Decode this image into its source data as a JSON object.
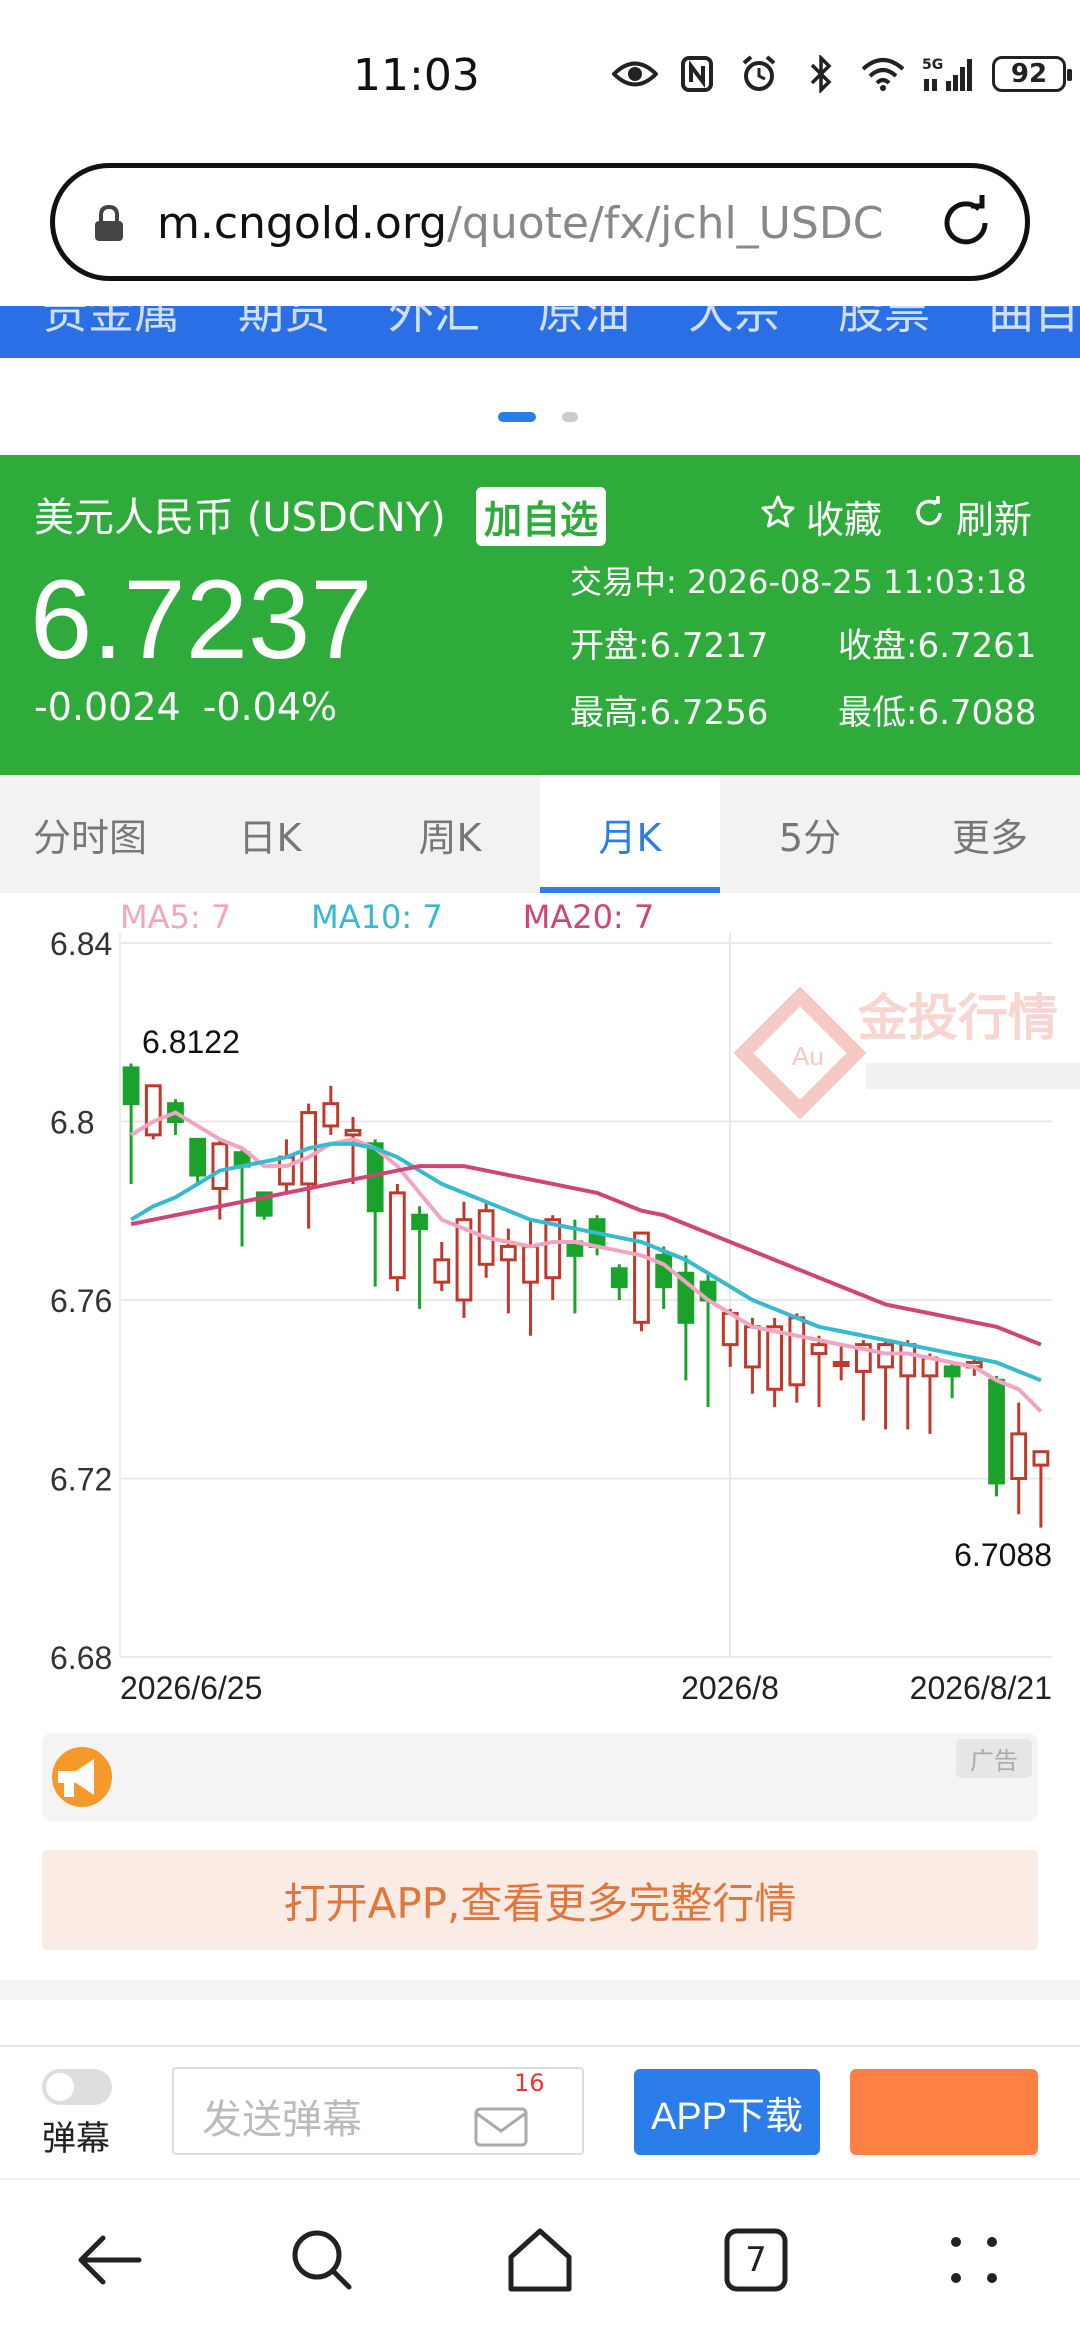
{
  "status_bar": {
    "time": "11:03",
    "battery": "92",
    "network": "5G"
  },
  "browser": {
    "url_domain": "m.cngold.org",
    "url_path": "/quote/fx/jchl_USDC"
  },
  "nav_strip": {
    "items": [
      "贵金属",
      "期货",
      "外汇",
      "原油",
      "大宗",
      "股票",
      "曲目"
    ]
  },
  "quote": {
    "name": "美元人民币 (USDCNY)",
    "add_watch": "加自选",
    "favorite": "收藏",
    "refresh": "刷新",
    "price": "6.7237",
    "change": "-0.0024",
    "change_pct": "-0.04%",
    "status": "交易中:  2026-08-25 11:03:18",
    "open": "开盘:6.7217",
    "close": "收盘:6.7261",
    "high": "最高:6.7256",
    "low": "最低:6.7088"
  },
  "tabs": [
    {
      "label": "分时图",
      "active": false
    },
    {
      "label": "日K",
      "active": false
    },
    {
      "label": "周K",
      "active": false
    },
    {
      "label": "月K",
      "active": true
    },
    {
      "label": "5分",
      "active": false
    },
    {
      "label": "更多",
      "active": false
    }
  ],
  "ma_legend": {
    "ma5": "MA5: 7",
    "ma10": "MA10: 7",
    "ma20": "MA20: 7"
  },
  "chart_data": {
    "type": "candlestick",
    "y_ticks": [
      "6.84",
      "6.8",
      "6.76",
      "6.72",
      "6.68"
    ],
    "ylim": [
      6.68,
      6.84
    ],
    "x_labels": [
      "2026/6/25",
      "2026/8",
      "2026/8/21"
    ],
    "max_label": "6.8122",
    "min_label": "6.7088",
    "watermark": "金投行情",
    "colors": {
      "up": "#c0392b",
      "down": "#1aa32a",
      "ma5": "#f2a5c0",
      "ma10": "#37b9cf",
      "ma20": "#d04478"
    },
    "candles": [
      {
        "o": 6.804,
        "c": 6.812,
        "h": 6.813,
        "l": 6.786,
        "dir": "down"
      },
      {
        "o": 6.808,
        "c": 6.797,
        "h": 6.808,
        "l": 6.796,
        "dir": "up"
      },
      {
        "o": 6.804,
        "c": 6.8,
        "h": 6.805,
        "l": 6.797,
        "dir": "down"
      },
      {
        "o": 6.796,
        "c": 6.788,
        "h": 6.796,
        "l": 6.786,
        "dir": "down"
      },
      {
        "o": 6.785,
        "c": 6.795,
        "h": 6.796,
        "l": 6.778,
        "dir": "up"
      },
      {
        "o": 6.79,
        "c": 6.793,
        "h": 6.794,
        "l": 6.772,
        "dir": "down"
      },
      {
        "o": 6.784,
        "c": 6.779,
        "h": 6.784,
        "l": 6.778,
        "dir": "down"
      },
      {
        "o": 6.786,
        "c": 6.792,
        "h": 6.796,
        "l": 6.784,
        "dir": "up"
      },
      {
        "o": 6.786,
        "c": 6.802,
        "h": 6.804,
        "l": 6.776,
        "dir": "up"
      },
      {
        "o": 6.799,
        "c": 6.804,
        "h": 6.808,
        "l": 6.797,
        "dir": "up"
      },
      {
        "o": 6.798,
        "c": 6.797,
        "h": 6.801,
        "l": 6.786,
        "dir": "up"
      },
      {
        "o": 6.795,
        "c": 6.78,
        "h": 6.796,
        "l": 6.763,
        "dir": "down"
      },
      {
        "o": 6.765,
        "c": 6.784,
        "h": 6.786,
        "l": 6.762,
        "dir": "up"
      },
      {
        "o": 6.779,
        "c": 6.776,
        "h": 6.781,
        "l": 6.758,
        "dir": "down"
      },
      {
        "o": 6.764,
        "c": 6.769,
        "h": 6.773,
        "l": 6.762,
        "dir": "up"
      },
      {
        "o": 6.76,
        "c": 6.778,
        "h": 6.782,
        "l": 6.756,
        "dir": "up"
      },
      {
        "o": 6.768,
        "c": 6.78,
        "h": 6.782,
        "l": 6.765,
        "dir": "up"
      },
      {
        "o": 6.769,
        "c": 6.772,
        "h": 6.776,
        "l": 6.757,
        "dir": "up"
      },
      {
        "o": 6.764,
        "c": 6.772,
        "h": 6.778,
        "l": 6.752,
        "dir": "up"
      },
      {
        "o": 6.765,
        "c": 6.778,
        "h": 6.779,
        "l": 6.76,
        "dir": "up"
      },
      {
        "o": 6.77,
        "c": 6.773,
        "h": 6.778,
        "l": 6.757,
        "dir": "down"
      },
      {
        "o": 6.778,
        "c": 6.772,
        "h": 6.779,
        "l": 6.77,
        "dir": "down"
      },
      {
        "o": 6.767,
        "c": 6.763,
        "h": 6.768,
        "l": 6.76,
        "dir": "down"
      },
      {
        "o": 6.755,
        "c": 6.775,
        "h": 6.775,
        "l": 6.753,
        "dir": "up"
      },
      {
        "o": 6.77,
        "c": 6.763,
        "h": 6.772,
        "l": 6.758,
        "dir": "down"
      },
      {
        "o": 6.766,
        "c": 6.755,
        "h": 6.77,
        "l": 6.742,
        "dir": "down"
      },
      {
        "o": 6.764,
        "c": 6.76,
        "h": 6.766,
        "l": 6.736,
        "dir": "down"
      },
      {
        "o": 6.757,
        "c": 6.75,
        "h": 6.758,
        "l": 6.745,
        "dir": "up"
      },
      {
        "o": 6.745,
        "c": 6.754,
        "h": 6.756,
        "l": 6.739,
        "dir": "up"
      },
      {
        "o": 6.74,
        "c": 6.754,
        "h": 6.756,
        "l": 6.736,
        "dir": "up"
      },
      {
        "o": 6.741,
        "c": 6.756,
        "h": 6.757,
        "l": 6.737,
        "dir": "up"
      },
      {
        "o": 6.748,
        "c": 6.75,
        "h": 6.752,
        "l": 6.736,
        "dir": "up"
      },
      {
        "o": 6.746,
        "c": 6.746,
        "h": 6.75,
        "l": 6.742,
        "dir": "up"
      },
      {
        "o": 6.744,
        "c": 6.75,
        "h": 6.751,
        "l": 6.733,
        "dir": "up"
      },
      {
        "o": 6.745,
        "c": 6.75,
        "h": 6.751,
        "l": 6.731,
        "dir": "up"
      },
      {
        "o": 6.743,
        "c": 6.75,
        "h": 6.751,
        "l": 6.731,
        "dir": "up"
      },
      {
        "o": 6.743,
        "c": 6.747,
        "h": 6.748,
        "l": 6.73,
        "dir": "up"
      },
      {
        "o": 6.745,
        "c": 6.743,
        "h": 6.746,
        "l": 6.738,
        "dir": "down"
      },
      {
        "o": 6.746,
        "c": 6.745,
        "h": 6.747,
        "l": 6.743,
        "dir": "up"
      },
      {
        "o": 6.742,
        "c": 6.719,
        "h": 6.743,
        "l": 6.716,
        "dir": "down"
      },
      {
        "o": 6.72,
        "c": 6.73,
        "h": 6.737,
        "l": 6.712,
        "dir": "up"
      },
      {
        "o": 6.723,
        "c": 6.726,
        "h": 6.726,
        "l": 6.709,
        "dir": "up"
      }
    ],
    "ma5": [
      6.797,
      6.8,
      6.802,
      6.799,
      6.796,
      6.794,
      6.79,
      6.79,
      6.792,
      6.795,
      6.796,
      6.794,
      6.79,
      6.784,
      6.778,
      6.776,
      6.774,
      6.773,
      6.772,
      6.773,
      6.773,
      6.772,
      6.771,
      6.77,
      6.768,
      6.764,
      6.76,
      6.757,
      6.754,
      6.753,
      6.752,
      6.751,
      6.75,
      6.749,
      6.748,
      6.748,
      6.747,
      6.746,
      6.745,
      6.742,
      6.74,
      6.735
    ],
    "ma10": [
      6.778,
      6.781,
      6.783,
      6.786,
      6.789,
      6.79,
      6.791,
      6.792,
      6.794,
      6.795,
      6.795,
      6.794,
      6.792,
      6.789,
      6.786,
      6.784,
      6.782,
      6.78,
      6.778,
      6.777,
      6.776,
      6.775,
      6.774,
      6.773,
      6.771,
      6.769,
      6.766,
      6.763,
      6.76,
      6.758,
      6.756,
      6.754,
      6.753,
      6.752,
      6.751,
      6.75,
      6.749,
      6.748,
      6.747,
      6.746,
      6.744,
      6.742
    ],
    "ma20": [
      6.777,
      6.778,
      6.779,
      6.78,
      6.781,
      6.782,
      6.783,
      6.784,
      6.785,
      6.786,
      6.787,
      6.788,
      6.789,
      6.79,
      6.79,
      6.79,
      6.789,
      6.788,
      6.787,
      6.786,
      6.785,
      6.784,
      6.782,
      6.78,
      6.779,
      6.777,
      6.775,
      6.773,
      6.771,
      6.769,
      6.767,
      6.765,
      6.763,
      6.761,
      6.759,
      6.758,
      6.757,
      6.756,
      6.755,
      6.754,
      6.752,
      6.75
    ]
  },
  "ad": {
    "tag": "广告",
    "open_app": "打开APP,查看更多完整行情"
  },
  "action_bar": {
    "danmu_label": "弹幕",
    "danmu_placeholder": "发送弹幕",
    "mail_count": "16",
    "app_download": "APP下载"
  },
  "sys_nav": {
    "tab_count": "7"
  }
}
